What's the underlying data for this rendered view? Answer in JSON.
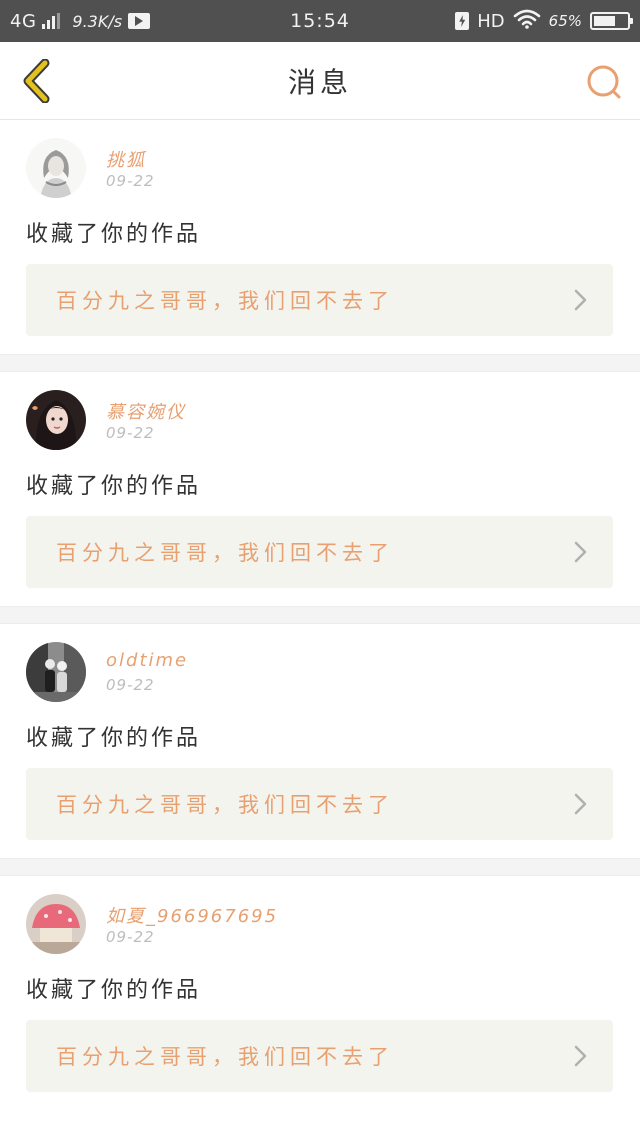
{
  "status_bar": {
    "network": "4G",
    "speed": "9.3K/s",
    "time": "15:54",
    "hd": "HD",
    "battery_percent": "65%",
    "battery_level": 0.65,
    "icons": [
      "signal-icon",
      "video-icon",
      "charge-icon",
      "wifi-icon",
      "battery-icon"
    ]
  },
  "header": {
    "title": "消息",
    "back_icon": "chevron-left-icon",
    "search_icon": "search-icon"
  },
  "colors": {
    "accent": "#e8a070",
    "back_icon": "#e3c21e",
    "card_link_bg": "#f3f4ee",
    "status_bar_bg": "#505050"
  },
  "notifications": [
    {
      "username": "挑狐",
      "date": "09-22",
      "action": "收藏了你的作品",
      "work_title": "百分九之哥哥，我们回不去了"
    },
    {
      "username": "慕容婉仪",
      "date": "09-22",
      "action": "收藏了你的作品",
      "work_title": "百分九之哥哥，我们回不去了"
    },
    {
      "username": "oldtime",
      "date": "09-22",
      "action": "收藏了你的作品",
      "work_title": "百分九之哥哥，我们回不去了"
    },
    {
      "username": "如夏_966967695",
      "date": "09-22",
      "action": "收藏了你的作品",
      "work_title": "百分九之哥哥，我们回不去了"
    }
  ]
}
